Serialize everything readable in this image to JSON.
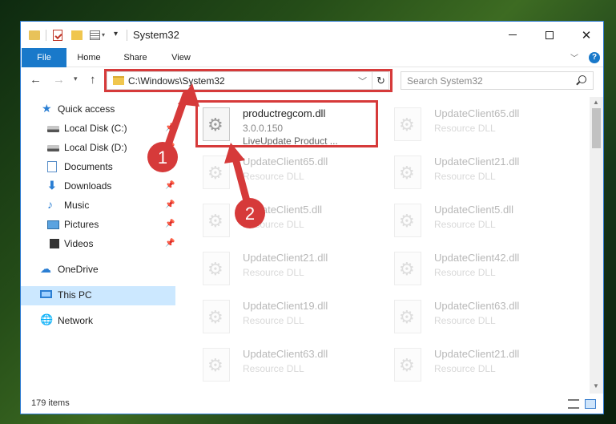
{
  "window": {
    "title": "System32"
  },
  "ribbon": {
    "tabs": [
      "File",
      "Home",
      "Share",
      "View"
    ],
    "help": "?"
  },
  "address_bar": {
    "path": "C:\\Windows\\System32",
    "refresh_glyph": "↻",
    "dropdown_glyph": "﹀"
  },
  "search": {
    "placeholder": "Search System32"
  },
  "sidebar": {
    "items": [
      {
        "label": "Quick access",
        "icon": "star-icon",
        "pinned": false
      },
      {
        "label": "Local Disk (C:)",
        "icon": "drive-icon",
        "pinned": true
      },
      {
        "label": "Local Disk (D:)",
        "icon": "drive-icon",
        "pinned": true
      },
      {
        "label": "Documents",
        "icon": "documents-icon",
        "pinned": true
      },
      {
        "label": "Downloads",
        "icon": "download-icon",
        "pinned": true
      },
      {
        "label": "Music",
        "icon": "music-icon",
        "pinned": true
      },
      {
        "label": "Pictures",
        "icon": "pictures-icon",
        "pinned": true
      },
      {
        "label": "Videos",
        "icon": "videos-icon",
        "pinned": true
      },
      {
        "label": "OneDrive",
        "icon": "cloud-icon",
        "pinned": false
      },
      {
        "label": "This PC",
        "icon": "computer-icon",
        "pinned": false,
        "selected": true
      },
      {
        "label": "Network",
        "icon": "network-icon",
        "pinned": false
      }
    ]
  },
  "files": {
    "featured": {
      "name": "productregcom.dll",
      "version": "3.0.0.150",
      "description": "LiveUpdate Product ..."
    },
    "grid": [
      {
        "name": "UpdateClient65.dll",
        "type": "Resource DLL"
      },
      {
        "name": "UpdateClient65.dll",
        "type": "Resource DLL"
      },
      {
        "name": "UpdateClient21.dll",
        "type": "Resource DLL"
      },
      {
        "name": "UpdateClient5.dll",
        "type": "Resource DLL"
      },
      {
        "name": "UpdateClient5.dll",
        "type": "Resource DLL"
      },
      {
        "name": "UpdateClient21.dll",
        "type": "Resource DLL"
      },
      {
        "name": "UpdateClient42.dll",
        "type": "Resource DLL"
      },
      {
        "name": "UpdateClient19.dll",
        "type": "Resource DLL"
      },
      {
        "name": "UpdateClient63.dll",
        "type": "Resource DLL"
      },
      {
        "name": "UpdateClient63.dll",
        "type": "Resource DLL"
      },
      {
        "name": "UpdateClient21.dll",
        "type": "Resource DLL"
      }
    ]
  },
  "status": {
    "item_count": "179 items"
  },
  "annotations": {
    "step1": "1",
    "step2": "2"
  },
  "colors": {
    "accent": "#1979ca",
    "highlight_red": "#d63a3a",
    "selection": "#cce8ff"
  }
}
